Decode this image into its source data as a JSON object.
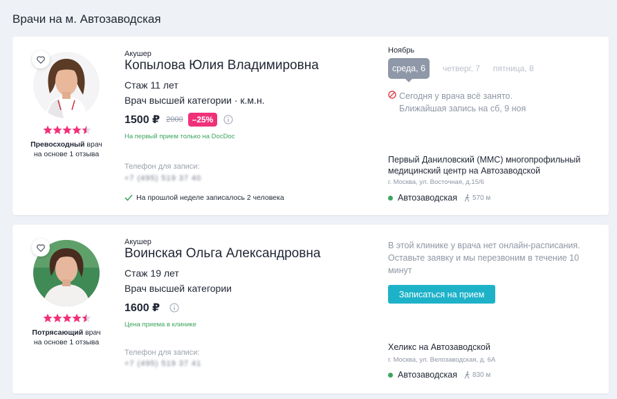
{
  "page_title": "Врачи на м. Автозаводская",
  "colors": {
    "accent": "#1eb2c8",
    "discount": "#f0317a",
    "star": "#f0317a",
    "green": "#3aa55d"
  },
  "doctors": [
    {
      "specialty": "Акушер",
      "name": "Копылова Юлия Владимировна",
      "experience": "Стаж 11 лет",
      "category": "Врач высшей категории · к.м.н.",
      "price": "1500 ₽",
      "old_price": "2000",
      "discount": "–25%",
      "price_note": "На первый прием только на DocDoc",
      "rating": 4.5,
      "rating_word": "Превосходный",
      "rating_suffix": " врач",
      "rating_reviews": "на основе 1 отзыва",
      "phone_label": "Телефон для записи:",
      "phone_value": "+7 (495) 519 37 40",
      "booked_note": "На прошлой неделе записалось 2 человека",
      "schedule": {
        "month": "Ноябрь",
        "days": [
          "среда, 6",
          "четверг, 7",
          "пятница, 8"
        ],
        "busy_line1": "Сегодня у врача всё занято.",
        "busy_line2": "Ближайшая запись на сб, 9 ноя"
      },
      "clinic": {
        "name": "Первый Даниловский (ММС) многопрофильный медицинский центр на Автозаводской",
        "address": "г. Москва, ул. Восточная, д.15/6",
        "metro": "Автозаводская",
        "distance": "570 м"
      }
    },
    {
      "specialty": "Акушер",
      "name": "Воинская Ольга Александровна",
      "experience": "Стаж 19 лет",
      "category": "Врач высшей категории",
      "price": "1600 ₽",
      "price_note": "Цена приема в клинике",
      "rating": 4.5,
      "rating_word": "Потрясающий",
      "rating_suffix": " врач",
      "rating_reviews": "на основе 1 отзыва",
      "phone_label": "Телефон для записи:",
      "phone_value": "+7 (495) 519 37 41",
      "no_online": "В этой клинике у врача нет онлайн-расписания. Оставьте заявку и мы перезвоним в течение 10 минут",
      "book_button": "Записаться на прием",
      "clinic": {
        "name": "Хеликс на Автозаводской",
        "address": "г. Москва, ул. Велозаводская, д. 6А",
        "metro": "Автозаводская",
        "distance": "830 м"
      }
    }
  ]
}
